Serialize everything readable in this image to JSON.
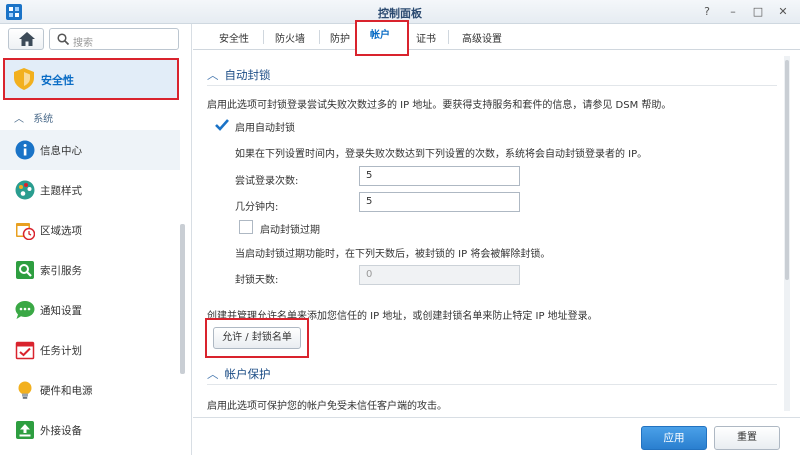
{
  "window": {
    "title": "控制面板",
    "help": "?",
    "minimize": "–",
    "maximize": "□",
    "close": "✕"
  },
  "sidebar": {
    "search_placeholder": "搜索",
    "active_item": "安全性",
    "section_label": "系统",
    "items": [
      {
        "label": "信息中心",
        "icon": "info-icon",
        "color": "#1a73c7"
      },
      {
        "label": "主题样式",
        "icon": "palette-icon",
        "color": "#2a9d8f"
      },
      {
        "label": "区域选项",
        "icon": "calendar-clock-icon",
        "color": "#e8a020"
      },
      {
        "label": "索引服务",
        "icon": "index-search-icon",
        "color": "#2e9e40"
      },
      {
        "label": "通知设置",
        "icon": "chat-bubble-icon",
        "color": "#3aa845"
      },
      {
        "label": "任务计划",
        "icon": "calendar-check-icon",
        "color": "#d9232d"
      },
      {
        "label": "硬件和电源",
        "icon": "lightbulb-icon",
        "color": "#f2b01e"
      },
      {
        "label": "外接设备",
        "icon": "upload-device-icon",
        "color": "#2e9e40"
      }
    ]
  },
  "tabs": [
    "安全性",
    "防火墙",
    "防护",
    "帐户",
    "证书",
    "高级设置"
  ],
  "active_tab": "帐户",
  "auto_block": {
    "title": "自动封锁",
    "description": "启用此选项可封锁登录尝试失败次数过多的 IP 地址。要获得支持服务和套件的信息，请参见 DSM 帮助。",
    "enable_label": "启用自动封锁",
    "enable_checked": true,
    "rule_description": "如果在下列设置时间内，登录失败次数达到下列设置的次数，系统将会自动封锁登录者的 IP。",
    "attempts_label": "尝试登录次数:",
    "attempts_value": "5",
    "minutes_label": "几分钟内:",
    "minutes_value": "5",
    "expire_label": "启动封锁过期",
    "expire_checked": false,
    "expire_description": "当启动封锁过期功能时，在下列天数后，被封锁的 IP 将会被解除封锁。",
    "days_label": "封锁天数:",
    "days_value": "0",
    "list_description": "创建并管理允许名单来添加您信任的 IP 地址，或创建封锁名单来防止特定 IP 地址登录。",
    "list_button": "允许 / 封锁名单"
  },
  "account_protection": {
    "title": "帐户保护",
    "description": "启用此选项可保护您的帐户免受未信任客户端的攻击。"
  },
  "footer": {
    "apply": "应用",
    "reset": "重置"
  }
}
